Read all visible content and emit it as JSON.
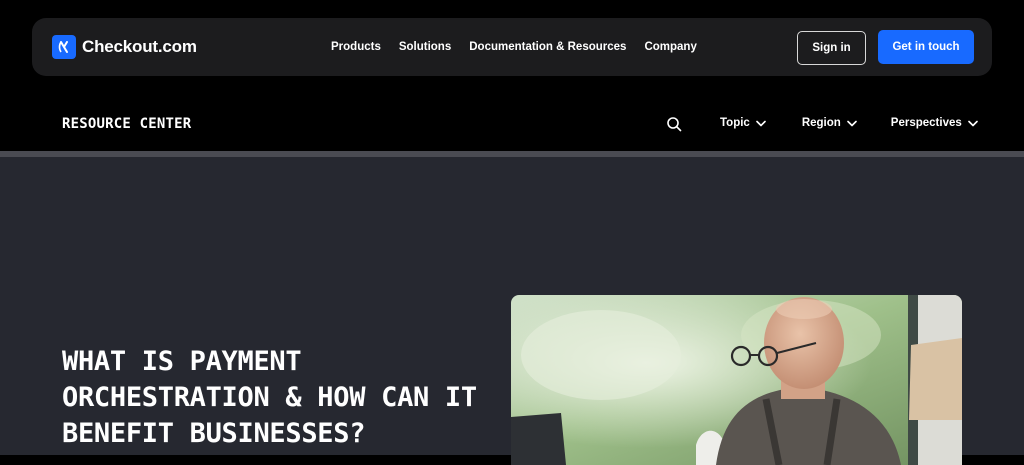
{
  "brand": {
    "name": "Checkout.com",
    "accent": "#186aff"
  },
  "nav": {
    "items": [
      "Products",
      "Solutions",
      "Documentation & Resources",
      "Company"
    ],
    "sign_in": "Sign in",
    "cta": "Get in touch"
  },
  "resource_bar": {
    "title": "RESOURCE CENTER",
    "search_icon": "search-icon",
    "filters": [
      "Topic",
      "Region",
      "Perspectives"
    ]
  },
  "hero": {
    "title": "WHAT IS PAYMENT ORCHESTRATION & HOW CAN IT BENEFIT BUSINESSES?",
    "image": "photo-of-man-with-glasses-using-laptop"
  }
}
